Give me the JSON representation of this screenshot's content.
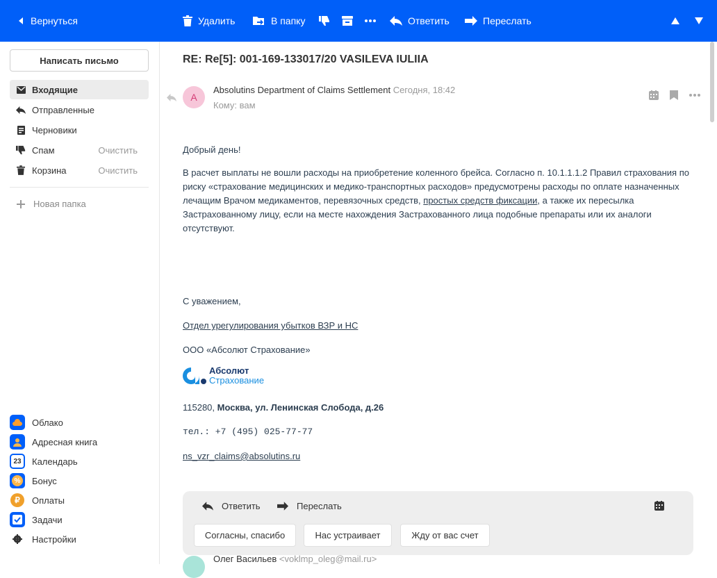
{
  "toolbar": {
    "back": "Вернуться",
    "delete": "Удалить",
    "move": "В папку",
    "reply": "Ответить",
    "forward": "Переслать"
  },
  "sidebar": {
    "compose": "Написать письмо",
    "folders": [
      {
        "label": "Входящие",
        "icon": "inbox-icon"
      },
      {
        "label": "Отправленные",
        "icon": "sent-icon"
      },
      {
        "label": "Черновики",
        "icon": "drafts-icon"
      },
      {
        "label": "Спам",
        "icon": "spam-icon",
        "action": "Очистить"
      },
      {
        "label": "Корзина",
        "icon": "trash-icon",
        "action": "Очистить"
      }
    ],
    "new_folder": "Новая папка",
    "apps": [
      {
        "label": "Облако",
        "icon": "cloud-icon"
      },
      {
        "label": "Адресная книга",
        "icon": "contacts-icon"
      },
      {
        "label": "Календарь",
        "icon": "calendar-icon",
        "badge": "23"
      },
      {
        "label": "Бонус",
        "icon": "bonus-icon",
        "badge": "%"
      },
      {
        "label": "Оплаты",
        "icon": "payments-icon",
        "badge": "₽"
      },
      {
        "label": "Задачи",
        "icon": "tasks-icon"
      },
      {
        "label": "Настройки",
        "icon": "settings-icon"
      }
    ]
  },
  "message": {
    "subject": "RE: Re[5]: 001-169-133017/20 VASILEVA IULIIA",
    "avatar_letter": "A",
    "sender": "Absolutins Department of Claims Settlement",
    "date": "Сегодня, 18:42",
    "to": "Кому: вам",
    "greeting": "Добрый день!",
    "para_1": "В расчет выплаты не вошли расходы на приобретение коленного брейса. Согласно п. 10.1.1.1.2 Правил страхования по",
    "para_2": "риску «страхование медицинских и медико-транспортных расходов» предусмотрены расходы по оплате назначенных",
    "para_3a": "лечащим Врачом медикаментов, перевязочных средств, ",
    "para_3_link": "простых средств фиксации",
    "para_3b": ", а также их пересылка",
    "para_4": "Застрахованному лицу, если на месте нахождения Застрахованного лица подобные препараты или их аналоги",
    "para_5": "отсутствуют.",
    "regards": "С уважением,",
    "department": "Отдел урегулирования убытков ВЗР и НС",
    "company": "ООО «Абсолют Страхование»",
    "logo_line1": "Абсолют",
    "logo_line2": "Страхование",
    "postcode": "115280, ",
    "address": "Москва, ул. Ленинская Слобода, д.26",
    "phone": "тел.: +7 (495) 025-77-77",
    "email": "ns_vzr_claims@absolutins.ru"
  },
  "reply_box": {
    "reply": "Ответить",
    "forward": "Переслать",
    "quick_replies": [
      "Согласны, спасибо",
      "Нас устраивает",
      "Жду от вас счет"
    ]
  },
  "next_message": {
    "sender": "Олег Васильев",
    "email": "<voklmp_oleg@mail.ru>"
  }
}
